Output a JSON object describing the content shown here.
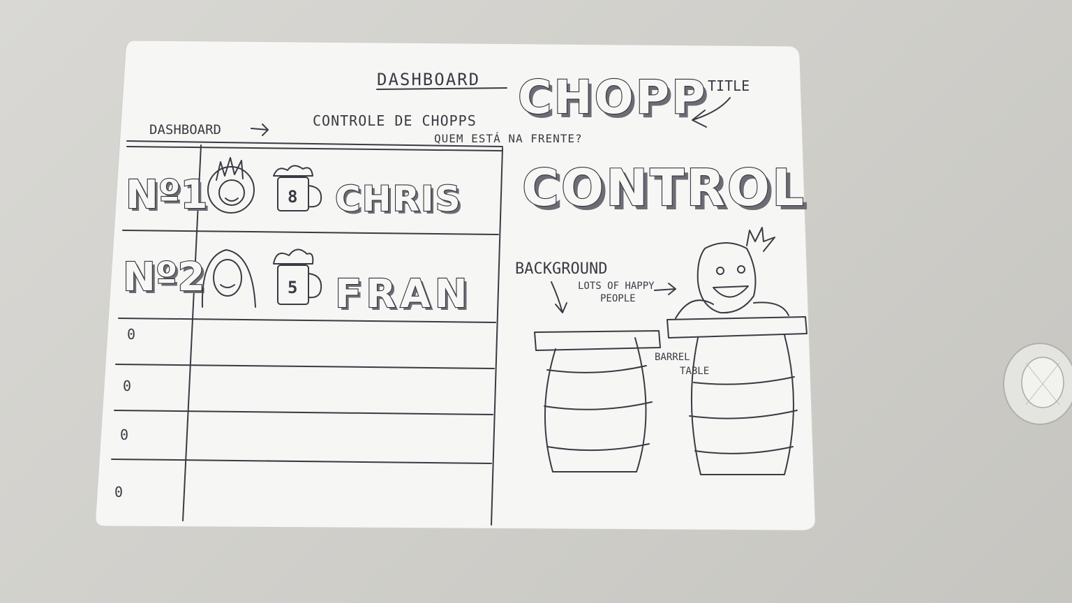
{
  "sketch": {
    "dashboard_heading": "DASHBOARD",
    "title_word": "CHOPP",
    "title_note": "TITLE",
    "subtitle_1": "CONTROLE DE CHOPPS",
    "subtitle_2": "QUEM ESTÁ NA FRENTE?",
    "dashboard_note": "DASHBOARD",
    "control_word": "CONTROL",
    "background_note": "BACKGROUND",
    "people_note_1": "LOTS OF HAPPY",
    "people_note_2": "PEOPLE",
    "barrel_note_1": "BARREL",
    "barrel_note_2": "TABLE",
    "rows": [
      {
        "rank": "Nº1",
        "beers": "8",
        "name": "CHRIS"
      },
      {
        "rank": "Nº2",
        "beers": "5",
        "name": "FRAN"
      },
      {
        "rank": "0"
      },
      {
        "rank": "0"
      },
      {
        "rank": "0"
      },
      {
        "rank": "0"
      }
    ]
  }
}
